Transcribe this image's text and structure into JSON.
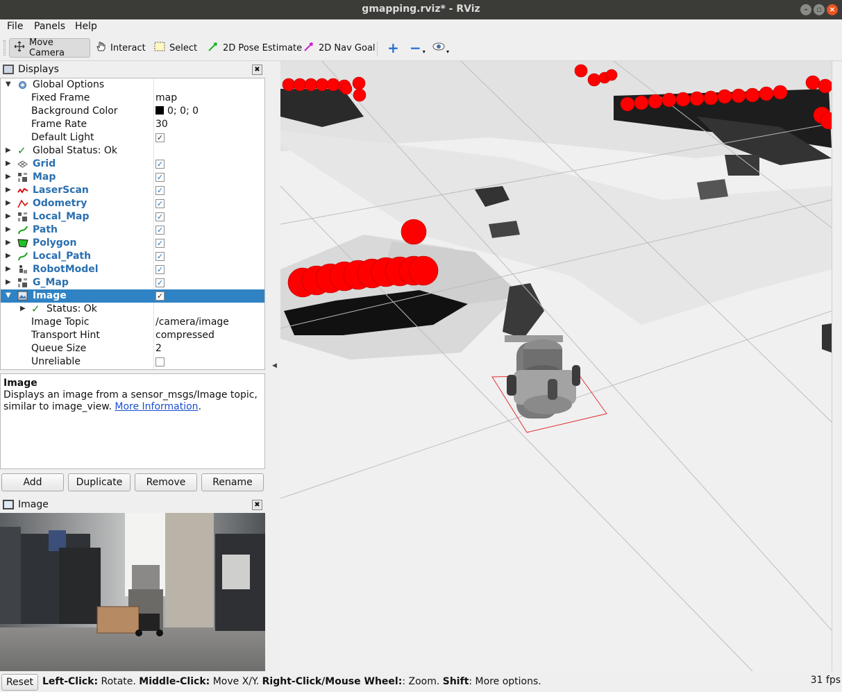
{
  "window": {
    "title": "gmapping.rviz* - RViz"
  },
  "menu": {
    "file": "File",
    "panels": "Panels",
    "help": "Help"
  },
  "toolbar": {
    "move_camera": "Move Camera",
    "interact": "Interact",
    "select": "Select",
    "pose_estimate": "2D Pose Estimate",
    "nav_goal": "2D Nav Goal"
  },
  "displays_panel": {
    "title": "Displays",
    "rows": {
      "global_options": "Global Options",
      "fixed_frame": {
        "label": "Fixed Frame",
        "value": "map"
      },
      "background_color": {
        "label": "Background Color",
        "value": "0; 0; 0"
      },
      "frame_rate": {
        "label": "Frame Rate",
        "value": "30"
      },
      "default_light": {
        "label": "Default Light",
        "checked": true
      },
      "global_status": "Global Status: Ok",
      "grid": "Grid",
      "map": "Map",
      "laserscan": "LaserScan",
      "odometry": "Odometry",
      "local_map": "Local_Map",
      "path": "Path",
      "polygon": "Polygon",
      "local_path": "Local_Path",
      "robot_model": "RobotModel",
      "g_map": "G_Map",
      "image": "Image",
      "status_ok": "Status: Ok",
      "image_topic": {
        "label": "Image Topic",
        "value": "/camera/image"
      },
      "transport_hint": {
        "label": "Transport Hint",
        "value": "compressed"
      },
      "queue_size": {
        "label": "Queue Size",
        "value": "2"
      },
      "unreliable": {
        "label": "Unreliable",
        "checked": false
      }
    }
  },
  "description": {
    "title": "Image",
    "text": "Displays an image from a sensor_msgs/Image topic, similar to image_view.",
    "link": "More Information",
    "trailing": "."
  },
  "buttons": {
    "add": "Add",
    "duplicate": "Duplicate",
    "remove": "Remove",
    "rename": "Rename"
  },
  "image_panel": {
    "title": "Image"
  },
  "status_bar": {
    "reset": "Reset",
    "left_click_key": "Left-Click:",
    "left_click_val": " Rotate. ",
    "middle_click_key": "Middle-Click:",
    "middle_click_val": " Move X/Y. ",
    "right_click_key": "Right-Click/Mouse Wheel:",
    "right_click_val": ": Zoom. ",
    "shift_key": "Shift",
    "shift_val": ": More options.",
    "fps": "31 fps"
  },
  "colors": {
    "selection": "#2f83c4",
    "laser_points": "#ff0000",
    "title_bar": "#3b3b38"
  }
}
